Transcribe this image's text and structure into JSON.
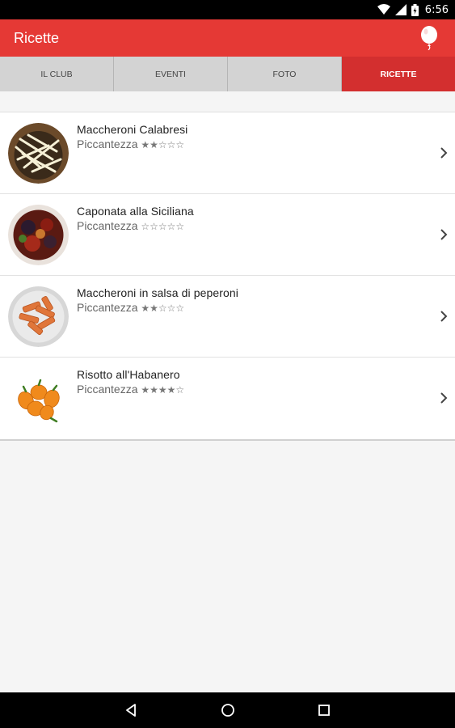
{
  "status_bar": {
    "time": "6:56"
  },
  "app_bar": {
    "title": "Ricette",
    "action_icon": "balloon-icon"
  },
  "tabs": [
    {
      "label": "IL CLUB",
      "active": false
    },
    {
      "label": "EVENTI",
      "active": false
    },
    {
      "label": "FOTO",
      "active": false
    },
    {
      "label": "RICETTE",
      "active": true
    }
  ],
  "recipes": [
    {
      "name": "Maccheroni Calabresi",
      "spice_label": "Piccantezza",
      "stars": "★★☆☆☆",
      "rating": 2,
      "image": "pasta-strands"
    },
    {
      "name": "Caponata alla Siciliana",
      "spice_label": "Piccantezza",
      "stars": "☆☆☆☆☆",
      "rating": 0,
      "image": "caponata"
    },
    {
      "name": "Maccheroni in salsa di peperoni",
      "spice_label": "Piccantezza",
      "stars": "★★☆☆☆",
      "rating": 2,
      "image": "penne"
    },
    {
      "name": "Risotto all'Habanero",
      "spice_label": "Piccantezza",
      "stars": "★★★★☆",
      "rating": 4,
      "image": "habanero-peppers"
    }
  ],
  "colors": {
    "primary": "#e53935",
    "tab_active": "#d32f2f",
    "tab_inactive": "#d3d3d3"
  },
  "nav": {
    "back": "back-icon",
    "home": "home-icon",
    "recents": "recents-icon"
  }
}
